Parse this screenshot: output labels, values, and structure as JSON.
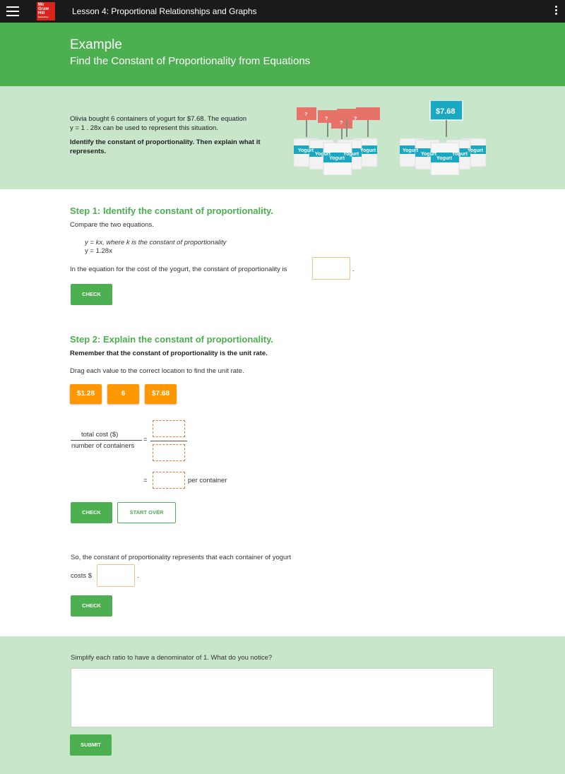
{
  "topbar": {
    "lesson_title": "Lesson 4: Proportional Relationships and Graphs",
    "logo_line1": "Mc",
    "logo_line2": "Graw",
    "logo_line3": "Hill",
    "logo_line4": "Education"
  },
  "header": {
    "title": "Example",
    "subtitle": "Find the Constant of Proportionality from Equations"
  },
  "problem": {
    "line1": "Olivia bought 6 containers of yogurt for $7.68. The equation",
    "line2": "y = 1 . 28x can be used to represent this situation.",
    "bold": "Identify the constant of proportionality. Then explain what it represents.",
    "sign_question": "?",
    "price_sign": "$7.68",
    "yogurt_label": "Yogurt"
  },
  "step1": {
    "title": "Step 1: Identify the constant of proportionality.",
    "intro": "Compare the two equations.",
    "eq1": "y = kx, where k is the constant of proportionality",
    "eq2": "y = 1.28x",
    "prompt": "In the equation for the cost of the yogurt, the constant of proportionality is",
    "period": ".",
    "check_label": "CHECK"
  },
  "step2": {
    "title": "Step 2: Explain the constant of proportionality.",
    "note": "Remember that the constant of proportionality is the unit rate.",
    "instruction": "Drag each value to the correct location to find the unit rate.",
    "tiles": [
      "$1.28",
      "6",
      "$7.68"
    ],
    "numerator": "total cost ($)",
    "denominator": "number of containers",
    "equals": "=",
    "per_container": "per container",
    "check_label": "CHECK",
    "start_over_label": "START OVER",
    "conclusion": "So, the constant of proportionality represents that each container of yogurt",
    "costs_prefix": "costs $",
    "period": ".",
    "check2_label": "CHECK"
  },
  "reflect": {
    "prompt": "Simplify each ratio to have a denominator of 1. What do you notice?",
    "submit_label": "SUBMIT"
  }
}
